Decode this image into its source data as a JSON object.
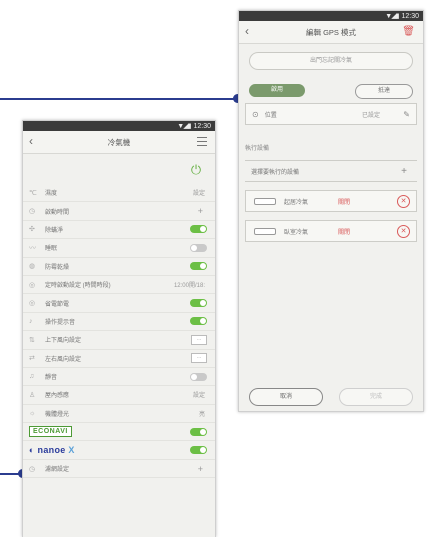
{
  "colors": {
    "callout": "#2b3c8f",
    "toggle_on": "#6cbf45",
    "accent_red": "#d95a5a"
  },
  "ac_screen": {
    "status_time": "12:30",
    "title": "冷氣機",
    "rows": [
      {
        "icon": "thermometer-icon",
        "glyph": "℃",
        "label": "濕度",
        "value": "設定",
        "control": "text"
      },
      {
        "icon": "timer-icon",
        "glyph": "◷",
        "label": "啟動時間",
        "value": "",
        "control": "plus"
      },
      {
        "icon": "fan-icon",
        "glyph": "✣",
        "label": "除蟎淨",
        "value": "",
        "control": "toggle_on"
      },
      {
        "icon": "moisture-icon",
        "glyph": "〰",
        "label": "睡眠",
        "value": "",
        "control": "toggle_off"
      },
      {
        "icon": "dry-icon",
        "glyph": "◍",
        "label": "防霉乾燥",
        "value": "",
        "control": "toggle_on"
      },
      {
        "icon": "schedule-icon",
        "glyph": "◎",
        "label": "定時啟動設定 (時間時段)",
        "value": "12:00開/18:",
        "control": "text"
      },
      {
        "icon": "power-save-icon",
        "glyph": "◎",
        "label": "省電節電",
        "value": "",
        "control": "toggle_on"
      },
      {
        "icon": "sound-icon",
        "glyph": "♪",
        "label": "操作提示音",
        "value": "",
        "control": "toggle_on"
      },
      {
        "icon": "vertical-swing-icon",
        "glyph": "⇅",
        "label": "上下風向設定",
        "value": "",
        "control": "mini"
      },
      {
        "icon": "horizontal-swing-icon",
        "glyph": "⇄",
        "label": "左右風向設定",
        "value": "",
        "control": "mini"
      },
      {
        "icon": "quiet-icon",
        "glyph": "♫",
        "label": "靜音",
        "value": "",
        "control": "toggle_off"
      },
      {
        "icon": "user-icon",
        "glyph": "♙",
        "label": "屋內感應",
        "value": "設定",
        "control": "text"
      },
      {
        "icon": "brightness-icon",
        "glyph": "☼",
        "label": "機體燈光",
        "value": "亮",
        "control": "text"
      }
    ],
    "econavi": {
      "label": "ECONAVI"
    },
    "nanoe": {
      "label": "nanoe",
      "suffix": "X"
    },
    "last_row": {
      "label": "濾網設定"
    }
  },
  "gps_screen": {
    "status_time": "12:30",
    "title": "編輯 GPS 模式",
    "header_state": "",
    "name_placeholder": "出門忘記關冷氣",
    "seg_on": "啟用",
    "seg_off": "抵達",
    "location_label": "位置",
    "location_edit": "已設定",
    "section_title": "執行設備",
    "add_device_label": "選擇要執行的設備",
    "devices": [
      {
        "name": "起居冷氣",
        "state": "關閉"
      },
      {
        "name": "臥室冷氣",
        "state": "關閉"
      }
    ],
    "cancel_label": "取消",
    "done_label": "完成"
  }
}
